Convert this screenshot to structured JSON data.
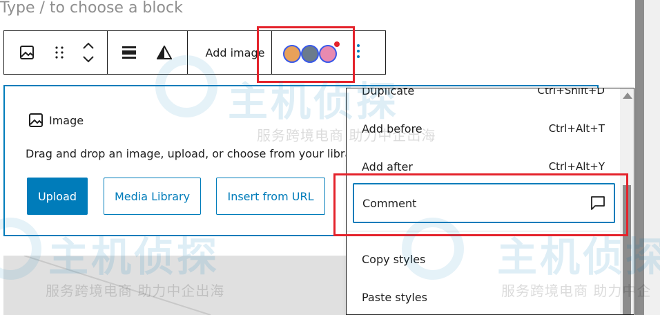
{
  "editor": {
    "placeholder": "Type / to choose a block"
  },
  "toolbar": {
    "add_image_label": "Add image",
    "avatars": [
      {
        "name": "avatar-1-icon",
        "color": "#e8a15a"
      },
      {
        "name": "avatar-2-icon",
        "color": "#6b7b8c"
      },
      {
        "name": "avatar-3-icon",
        "color": "#e88ab0"
      }
    ],
    "notification_color": "#e4222b"
  },
  "image_block": {
    "title": "Image",
    "description": "Drag and drop an image, upload, or choose from your libra",
    "upload_label": "Upload",
    "media_library_label": "Media Library",
    "insert_url_label": "Insert from URL"
  },
  "menu": {
    "items": [
      {
        "label": "Duplicate",
        "shortcut": "Ctrl+Shift+D"
      },
      {
        "label": "Add before",
        "shortcut": "Ctrl+Alt+T"
      },
      {
        "label": "Add after",
        "shortcut": "Ctrl+Alt+Y"
      },
      {
        "label": "Comment",
        "icon": "comment-icon"
      },
      {
        "label": "Copy styles"
      },
      {
        "label": "Paste styles"
      }
    ]
  },
  "watermark": {
    "brand": "主机侦探",
    "tagline": "服务跨境电商 助力中企出海",
    "tagline_partial": "服务跨境电商 助力中企"
  },
  "colors": {
    "accent": "#007cba",
    "highlight": "#e4222b",
    "avatar_ring": "#3858e9"
  }
}
